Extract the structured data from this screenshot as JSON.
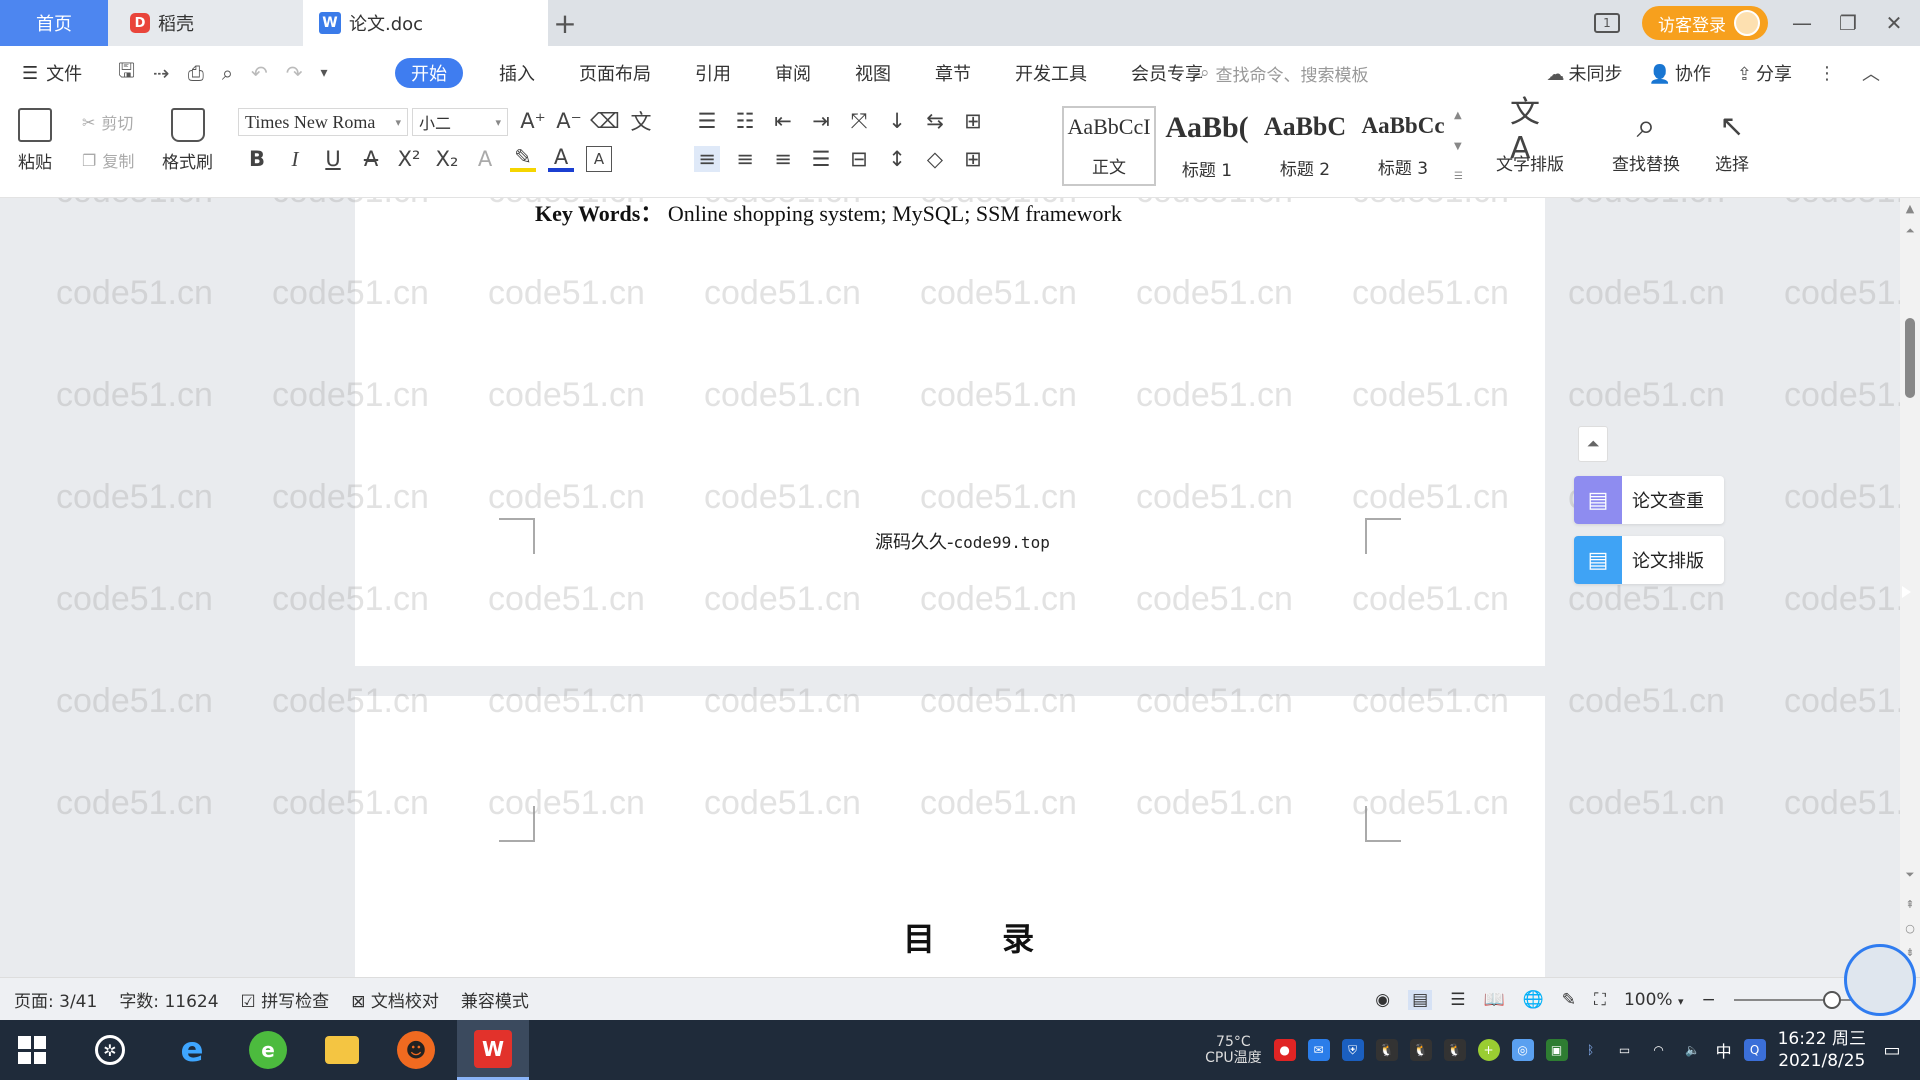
{
  "tabs": {
    "home": "首页",
    "daoke": "稻壳",
    "doc": "论文.doc"
  },
  "titlebar": {
    "login": "访客登录",
    "page_indicator": "1"
  },
  "menu": {
    "file": "文件",
    "tabs": [
      "开始",
      "插入",
      "页面布局",
      "引用",
      "审阅",
      "视图",
      "章节",
      "开发工具",
      "会员专享"
    ],
    "search_placeholder": "查找命令、搜索模板",
    "sync": "未同步",
    "collab": "协作",
    "share": "分享"
  },
  "ribbon": {
    "paste": "粘贴",
    "cut": "剪切",
    "copy": "复制",
    "format_painter": "格式刷",
    "font_name": "Times New Roma",
    "font_size": "小二",
    "styles": [
      {
        "preview": "AaBbCcI",
        "label": "正文"
      },
      {
        "preview": "AaBb(",
        "label": "标题 1"
      },
      {
        "preview": "AaBbC",
        "label": "标题 2"
      },
      {
        "preview": "AaBbCc",
        "label": "标题 3"
      }
    ],
    "text_layout": "文字排版",
    "find_replace": "查找替换",
    "select": "选择"
  },
  "document": {
    "keywords_label": "Key Words：",
    "keywords_text": "Online shopping system; MySQL; SSM framework",
    "footer_cn": "源码久久-",
    "footer_url": "code99.top",
    "toc_title": "目 录",
    "watermark": "code51.cn"
  },
  "side_panel": {
    "check": "论文查重",
    "layout": "论文排版"
  },
  "status": {
    "page": "页面: 3/41",
    "words": "字数: 11624",
    "spell": "拼写检查",
    "proof": "文档校对",
    "compat": "兼容模式",
    "zoom": "100%",
    "zoom_level": 0.7
  },
  "taskbar": {
    "cpu_temp": "75°C",
    "cpu_label": "CPU温度",
    "ime": "中",
    "time": "16:22 周三",
    "date": "2021/8/25"
  }
}
